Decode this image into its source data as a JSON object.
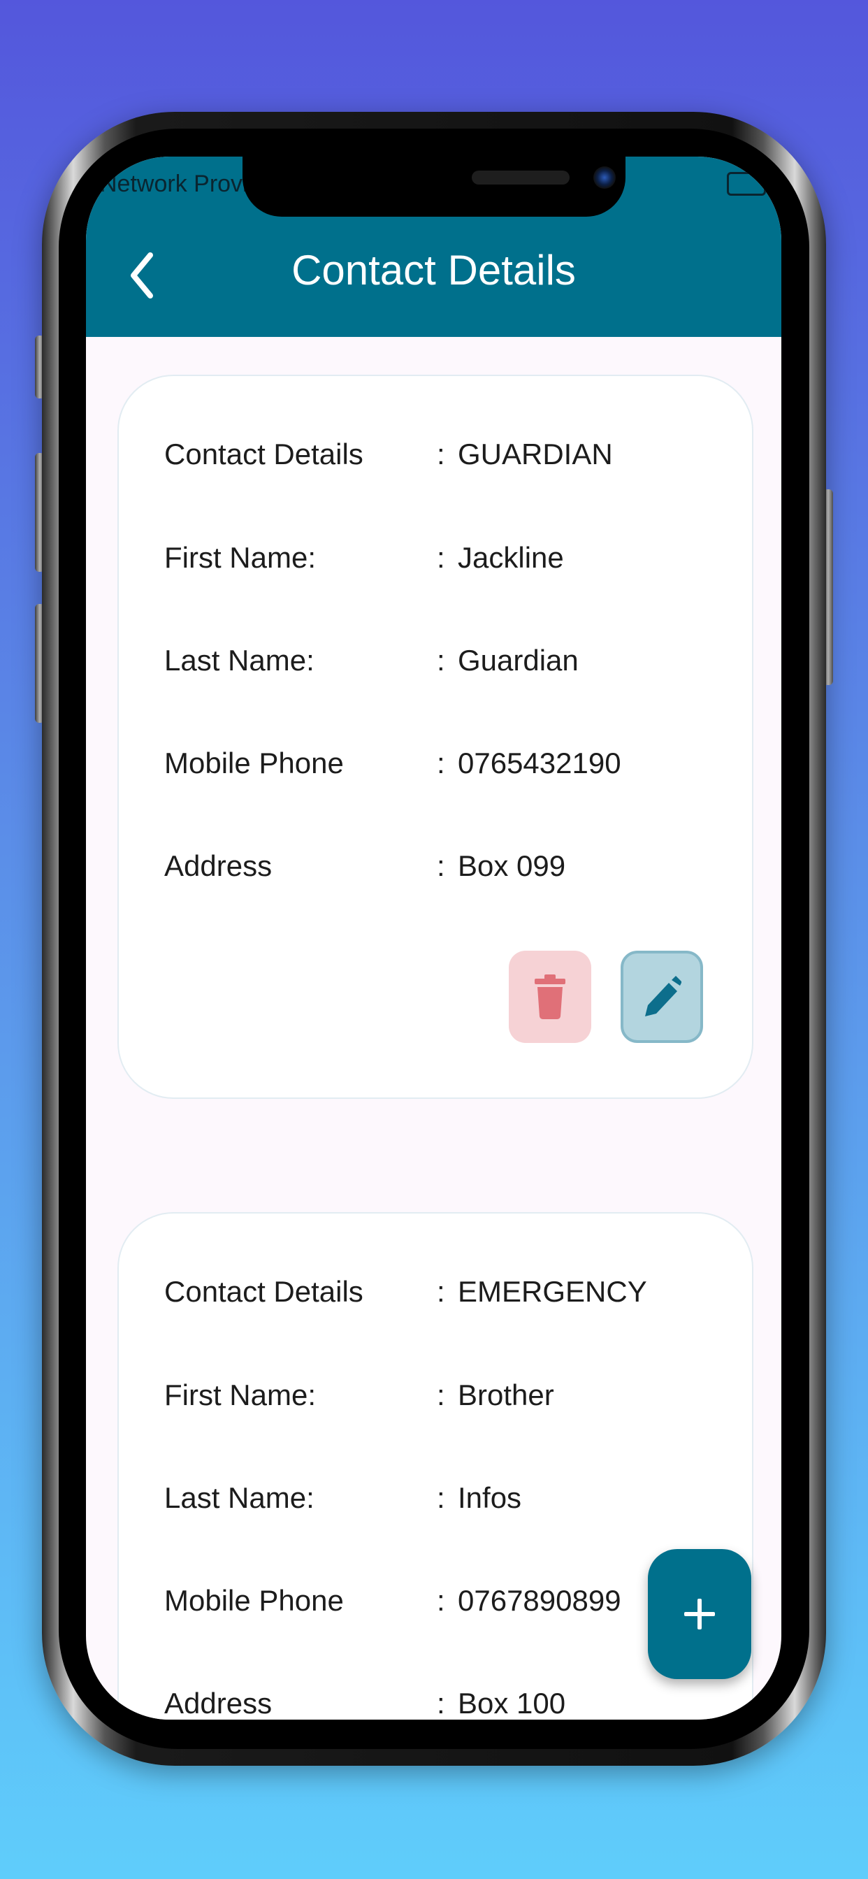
{
  "status_bar": {
    "carrier": "Network Provi"
  },
  "header": {
    "title": "Contact Details",
    "background_color": "#00708c",
    "back_icon": "chevron-left-icon"
  },
  "cards": [
    {
      "rows": [
        {
          "label": "Contact Details",
          "separator": ":",
          "value": "GUARDIAN"
        },
        {
          "label": "First Name:",
          "separator": ":",
          "value": "Jackline"
        },
        {
          "label": "Last Name:",
          "separator": ":",
          "value": "Guardian"
        },
        {
          "label": "Mobile Phone",
          "separator": ":",
          "value": "0765432190"
        },
        {
          "label": "Address",
          "separator": ":",
          "value": "Box 099"
        }
      ],
      "actions": {
        "delete_icon": "trash-icon",
        "edit_icon": "pencil-icon",
        "delete_color": "#f6d2d5",
        "edit_color": "#b3d5df"
      }
    },
    {
      "rows": [
        {
          "label": "Contact Details",
          "separator": ":",
          "value": "EMERGENCY"
        },
        {
          "label": "First Name:",
          "separator": ":",
          "value": "Brother"
        },
        {
          "label": "Last Name:",
          "separator": ":",
          "value": "Infos"
        },
        {
          "label": "Mobile Phone",
          "separator": ":",
          "value": "0767890899"
        },
        {
          "label": "Address",
          "separator": ":",
          "value": "Box 100"
        }
      ]
    }
  ],
  "fab": {
    "icon": "plus-icon",
    "color": "#00708c"
  }
}
